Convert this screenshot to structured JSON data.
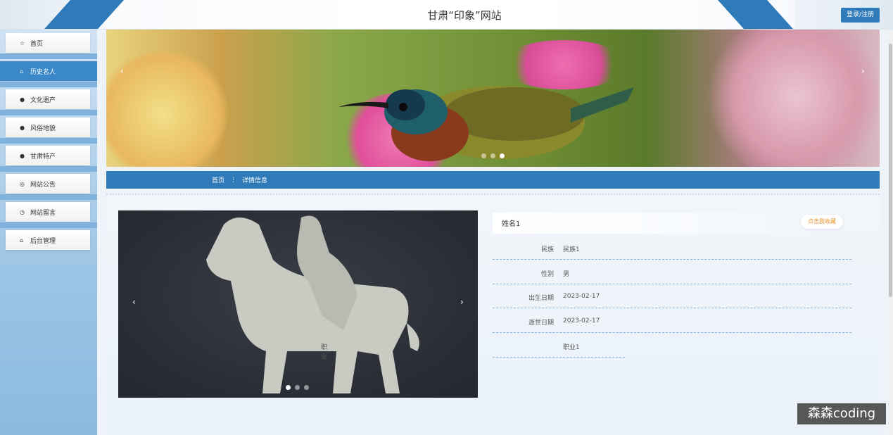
{
  "header": {
    "title": "甘肃“印象”网站",
    "login_label": "登录/注册"
  },
  "sidebar": {
    "items": [
      {
        "label": "首页",
        "icon": "star-icon",
        "active": false
      },
      {
        "label": "历史名人",
        "icon": "briefcase-icon",
        "active": true
      },
      {
        "label": "文化遗产",
        "icon": "info-circle-icon",
        "active": false
      },
      {
        "label": "风俗地貌",
        "icon": "question-circle-icon",
        "active": false
      },
      {
        "label": "甘肃特产",
        "icon": "info-circle-icon",
        "active": false
      },
      {
        "label": "网站公告",
        "icon": "settings-icon",
        "active": false
      },
      {
        "label": "网站留言",
        "icon": "clock-icon",
        "active": false
      },
      {
        "label": "后台管理",
        "icon": "lock-icon",
        "active": false
      }
    ]
  },
  "banner": {
    "prev_arrow": "‹",
    "next_arrow": "›",
    "slide_count": 3,
    "active_slide": 3
  },
  "breadcrumb": {
    "home": "首页",
    "separator": "⋮",
    "current": "详情信息"
  },
  "detail": {
    "name": "姓名1",
    "favorite_label": "点击我收藏",
    "carousel": {
      "prev_arrow": "‹",
      "next_arrow": "›",
      "slide_count": 3,
      "active_slide": 1
    },
    "fields": [
      {
        "label": "民族",
        "value": "民族1"
      },
      {
        "label": "性别",
        "value": "男"
      },
      {
        "label": "出生日期",
        "value": "2023-02-17"
      },
      {
        "label": "逝世日期",
        "value": "2023-02-17"
      },
      {
        "label": "职业",
        "value": "职业1"
      }
    ]
  },
  "watermark": "森森coding",
  "colors": {
    "primary": "#2f7ab8",
    "sidebar_bg": "#9cc4e4",
    "favorite": "#e8932a"
  }
}
